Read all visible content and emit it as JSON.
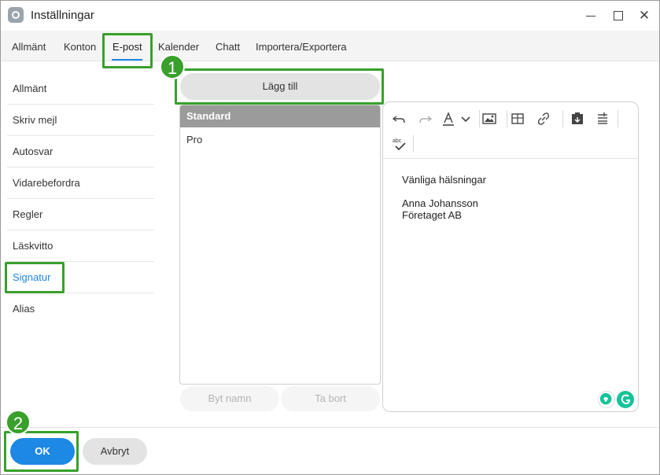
{
  "window": {
    "title": "Inställningar"
  },
  "tabs": [
    {
      "label": "Allmänt"
    },
    {
      "label": "Konton"
    },
    {
      "label": "E-post"
    },
    {
      "label": "Kalender"
    },
    {
      "label": "Chatt"
    },
    {
      "label": "Importera/Exportera"
    }
  ],
  "active_tab": "E-post",
  "sidebar": {
    "items": [
      {
        "label": "Allmänt"
      },
      {
        "label": "Skriv mejl"
      },
      {
        "label": "Autosvar"
      },
      {
        "label": "Vidarebefordra"
      },
      {
        "label": "Regler"
      },
      {
        "label": "Läskvitto"
      },
      {
        "label": "Signatur"
      },
      {
        "label": "Alias"
      }
    ],
    "active": "Signatur"
  },
  "signature": {
    "add_label": "Lägg till",
    "list": [
      {
        "name": "Standard",
        "selected": true
      },
      {
        "name": "Pro",
        "selected": false
      }
    ],
    "rename_label": "Byt namn",
    "delete_label": "Ta bort"
  },
  "editor": {
    "toolbar_icons": [
      "undo-icon",
      "redo-icon",
      "font-color-icon",
      "chevron-down-icon",
      "insert-image-icon",
      "table-icon",
      "link-icon",
      "paste-icon",
      "clear-format-icon",
      "spellcheck-icon"
    ],
    "content": {
      "line1": "Vänliga hälsningar",
      "line2": "Anna Johansson",
      "line3": "Företaget AB"
    },
    "badges": [
      "lightbulb-icon",
      "grammarly-icon"
    ]
  },
  "footer": {
    "ok_label": "OK",
    "cancel_label": "Avbryt"
  },
  "annotations": {
    "step1": "1",
    "step2": "2",
    "color": "#38a02b"
  },
  "colors": {
    "accent": "#1e88e5",
    "selected_row": "#9b9b9b",
    "annotation": "#38a02b"
  }
}
